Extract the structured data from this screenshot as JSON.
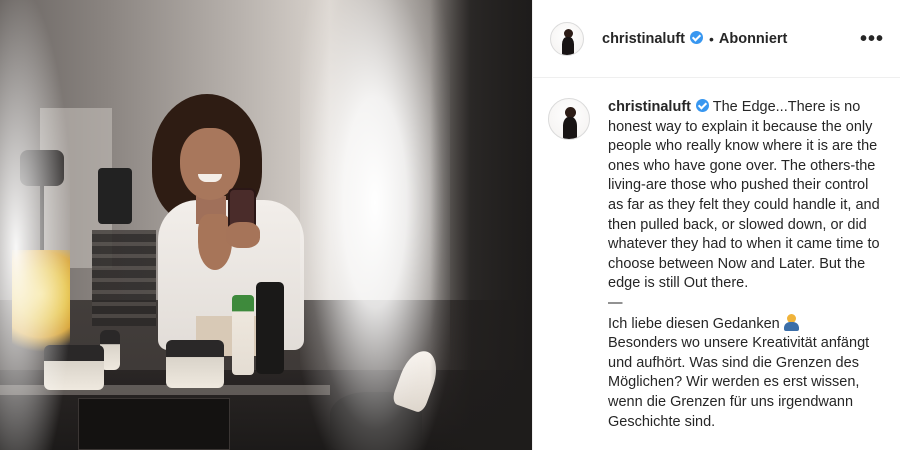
{
  "post": {
    "image_alt": "Instagram post photo"
  },
  "header": {
    "username": "christinaluft",
    "separator": "•",
    "follow_label": "Abonniert",
    "more_label": "•••"
  },
  "caption": {
    "username": "christinaluft",
    "paragraph_en": "The Edge...There is no honest way to explain it because the only people who really know where it is are the ones who have gone over. The others-the living-are those who pushed their control as far as they felt they could handle it, and then pulled back, or slowed down, or did whatever they had to when it came time to choose between Now and Later. But the edge is still Out there.",
    "divider": "—",
    "paragraph_de_1": "Ich liebe diesen Gedanken",
    "paragraph_de_2": "Besonders wo unsere Kreativität anfängt und aufhört. Was sind die Grenzen des Möglichen? Wir werden es erst wissen, wenn die Grenzen für uns irgendwann Geschichte sind.",
    "emoji": "person-raising-hand-emoji"
  },
  "colors": {
    "verified_badge": "#3897f0",
    "text": "#262626",
    "border": "#efefef"
  },
  "icons": [
    "verified-badge-icon",
    "more-options-icon"
  ]
}
